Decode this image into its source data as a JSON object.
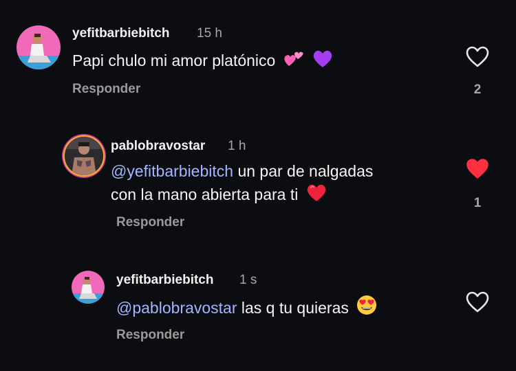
{
  "comments": [
    {
      "username": "yefitbarbiebitch",
      "time": "15 h",
      "text": "Papi chulo mi amor platónico",
      "emojis": [
        "two-hearts-emoji",
        "purple-heart-emoji"
      ],
      "reply_label": "Responder",
      "like_count": "2",
      "liked": false
    },
    {
      "username": "pablobravostar",
      "time": "1 h",
      "mention": "@yefitbarbiebitch",
      "text_line1": " un par de nalgadas",
      "text_line2": "con la mano abierta para ti",
      "emojis": [
        "red-heart-emoji"
      ],
      "reply_label": "Responder",
      "like_count": "1",
      "liked": true
    },
    {
      "username": "yefitbarbiebitch",
      "time": "1 s",
      "mention": "@pablobravostar",
      "text": " las q tu quieras",
      "emojis": [
        "heart-eyes-emoji"
      ],
      "reply_label": "Responder",
      "liked": false
    }
  ],
  "colors": {
    "background": "#0c0d11",
    "mention": "#a2b6ff",
    "like_active": "#ff3040",
    "muted": "#a8a8a8"
  }
}
